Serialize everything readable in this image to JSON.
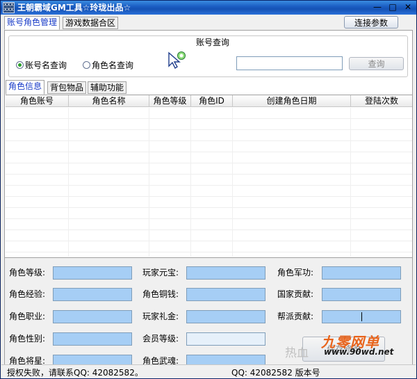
{
  "window": {
    "icon_text": "XXX XXX",
    "title": "王朝霸域GM工具☆玲珑出品☆",
    "controls": {
      "minimize": "—",
      "maximize": "□",
      "close": "✕"
    }
  },
  "main_tabs": [
    "账号角色管理",
    "游戏数据合区"
  ],
  "connect_button": "连接参数",
  "query_group": {
    "title": "账号查询",
    "options": [
      {
        "label": "账号名查询",
        "checked": true
      },
      {
        "label": "角色名查询",
        "checked": false
      }
    ],
    "input_value": "",
    "query_button": "查询"
  },
  "inner_tabs": [
    "角色信息",
    "背包物品",
    "辅助功能"
  ],
  "grid": {
    "columns": [
      "角色账号",
      "角色名称",
      "角色等级",
      "角色ID",
      "创建角色日期",
      "登陆次数"
    ],
    "rows": []
  },
  "form": {
    "col1": [
      {
        "label": "角色等级:",
        "value": ""
      },
      {
        "label": "角色经验:",
        "value": ""
      },
      {
        "label": "角色职业:",
        "value": ""
      },
      {
        "label": "角色性别:",
        "value": ""
      },
      {
        "label": "角色将星:",
        "value": ""
      }
    ],
    "col2": [
      {
        "label": "玩家元宝:",
        "value": ""
      },
      {
        "label": "角色铜钱:",
        "value": ""
      },
      {
        "label": "玩家礼金:",
        "value": ""
      },
      {
        "label": "会员等级:",
        "value": ""
      },
      {
        "label": "角色武魂:",
        "value": ""
      }
    ],
    "col3": [
      {
        "label": "角色军功:",
        "value": ""
      },
      {
        "label": "国家贡献:",
        "value": ""
      },
      {
        "label": "帮派贡献:",
        "value": ""
      }
    ],
    "save_button": "保存修改"
  },
  "status": {
    "left": "授权失败，请联系QQ: 42082582。",
    "right": "QQ: 42082582  版本号"
  },
  "watermark": {
    "main": "九零网单",
    "url": "www.90wd.net",
    "faint": "热血"
  },
  "colors": {
    "title_bar": "#1552b5",
    "input_fill": "#a6cef5",
    "tab_active_text": "#1a3cc8",
    "watermark": "#e8641c"
  }
}
